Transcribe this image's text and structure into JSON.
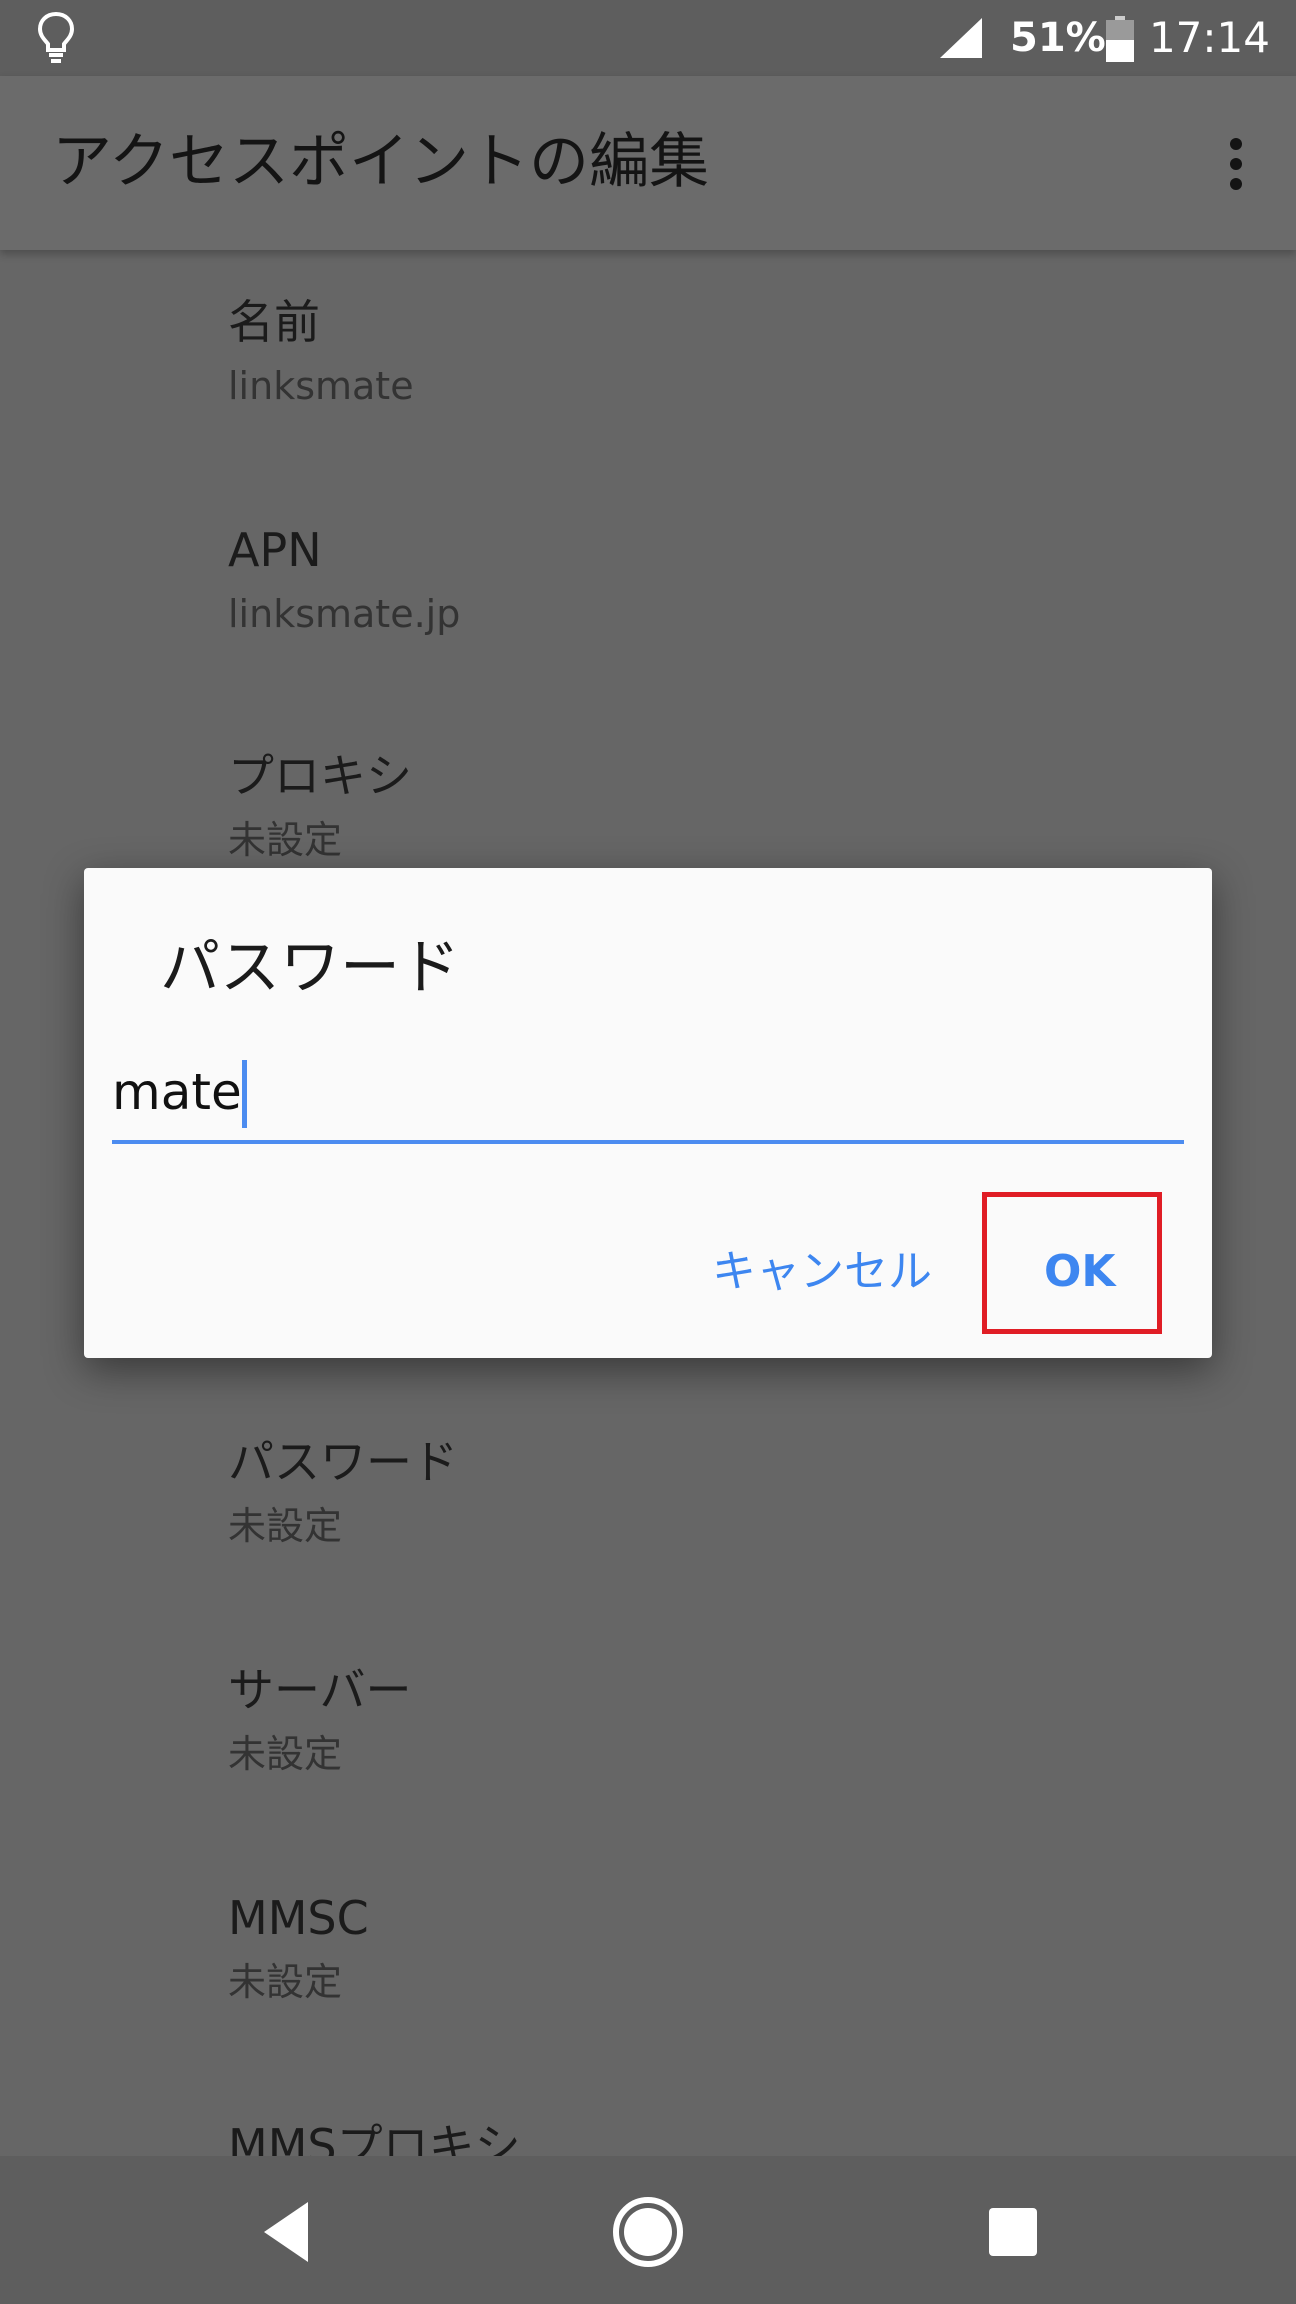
{
  "status_bar": {
    "battery_percent": "51%",
    "time": "17:14",
    "icons": [
      "lightbulb-icon",
      "signal-icon",
      "battery-icon"
    ]
  },
  "app_bar": {
    "title": "アクセスポイントの編集",
    "menu_icon": "more-vert-icon"
  },
  "settings": [
    {
      "label": "名前",
      "value": "linksmate"
    },
    {
      "label": "APN",
      "value": "linksmate.jp"
    },
    {
      "label": "プロキシ",
      "value": "未設定"
    },
    {
      "label": "パスワード",
      "value": "未設定"
    },
    {
      "label": "サーバー",
      "value": "未設定"
    },
    {
      "label": "MMSC",
      "value": "未設定"
    },
    {
      "label": "MMSプロキシ",
      "value": ""
    }
  ],
  "dialog": {
    "title": "パスワード",
    "input_value": "mate",
    "cancel_label": "キャンセル",
    "ok_label": "OK"
  },
  "nav_bar": {
    "icons": [
      "back-icon",
      "home-icon",
      "recents-icon"
    ]
  },
  "colors": {
    "accent": "#3d86f0",
    "highlight": "#e01d25",
    "scrim": "#666666"
  }
}
